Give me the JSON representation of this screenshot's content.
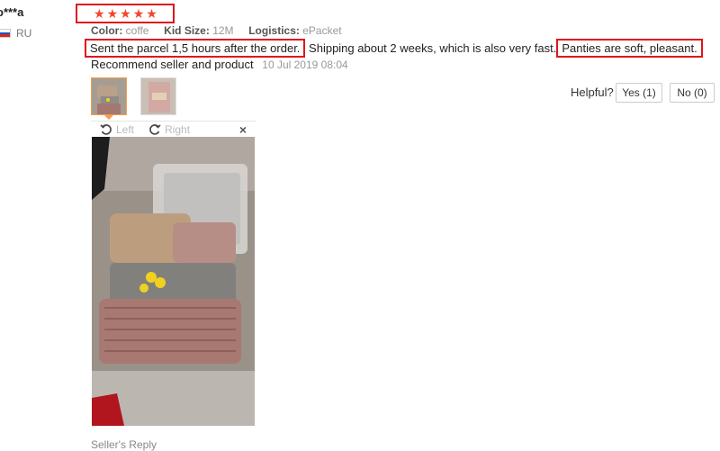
{
  "reviewer": {
    "name": "o***a",
    "country": "RU"
  },
  "rating": {
    "stars": 5,
    "max": 5
  },
  "attributes": [
    {
      "key": "Color:",
      "value": "coffe"
    },
    {
      "key": "Kid Size:",
      "value": "12M"
    },
    {
      "key": "Logistics:",
      "value": "ePacket"
    }
  ],
  "review": {
    "part1": "Sent the parcel 1,5 hours after the order.",
    "part2": " Shipping about 2 weeks, which is also very fast.",
    "part3": "Panties are soft, pleasant.",
    "line2": "Recommend seller and product",
    "date": "10 Jul 2019 08:04"
  },
  "helpful": {
    "label": "Helpful?",
    "yes": "Yes (1)",
    "no": "No (0)"
  },
  "viewer": {
    "left": "Left",
    "right": "Right",
    "close": "×"
  },
  "seller_reply": "Seller's Reply",
  "colors": {
    "star": "#f5442d",
    "highlight": "#e0151a",
    "thumb_selected": "#f39e4c"
  }
}
